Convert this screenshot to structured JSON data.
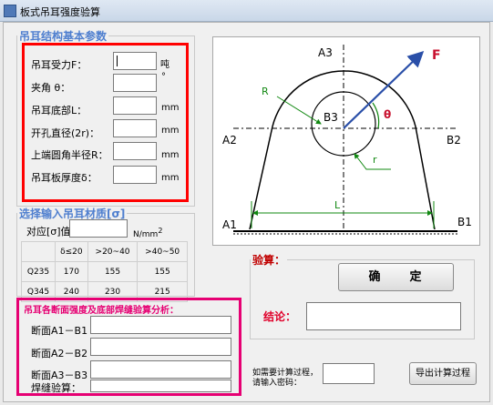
{
  "window": {
    "title": "板式吊耳强度验算"
  },
  "params": {
    "legend": "吊耳结构基本参数",
    "fields": [
      {
        "label": "吊耳受力F：",
        "unit": "吨"
      },
      {
        "label": "夹角 θ：",
        "unit": "°"
      },
      {
        "label": "吊耳底部L：",
        "unit": "mm"
      },
      {
        "label": "开孔直径(2r)：",
        "unit": "mm"
      },
      {
        "label": "上端圆角半径R：",
        "unit": "mm"
      },
      {
        "label": "吊耳板厚度δ：",
        "unit": "mm"
      }
    ]
  },
  "material": {
    "legend": "选择输入吊耳材质[σ]",
    "label": "对应[σ]值",
    "unit": "N/mm",
    "unit_sup": "2",
    "headers": [
      "",
      "δ≤20",
      ">20~40",
      ">40~50"
    ],
    "rows": [
      [
        "Q235",
        "170",
        "155",
        "155"
      ],
      [
        "Q345",
        "240",
        "230",
        "215"
      ]
    ]
  },
  "analysis": {
    "legend": "吊耳各断面强度及底部焊缝验算分析：",
    "rows": [
      "断面A1－B1",
      "断面A2－B2",
      "断面A3－B3",
      "焊缝验算："
    ]
  },
  "diagram": {
    "labels": {
      "A3": "A3",
      "F": "F",
      "R": "R",
      "theta": "θ",
      "B3": "B3",
      "A2": "A2",
      "B2": "B2",
      "r": "r",
      "L": "L",
      "A1": "A1",
      "B1": "B1"
    }
  },
  "verify": {
    "legend": "验算：",
    "confirm_label": "确　　定",
    "conclusion_label": "结论："
  },
  "export": {
    "hint_line1": "如需要计算过程，",
    "hint_line2": "请输入密码：",
    "button_label": "导出计算过程"
  },
  "colors": {
    "accent_blue": "#4f7fcf",
    "highlight_red": "#ff0000",
    "highlight_magenta": "#e60073",
    "conclusion_red": "#e0002a"
  }
}
